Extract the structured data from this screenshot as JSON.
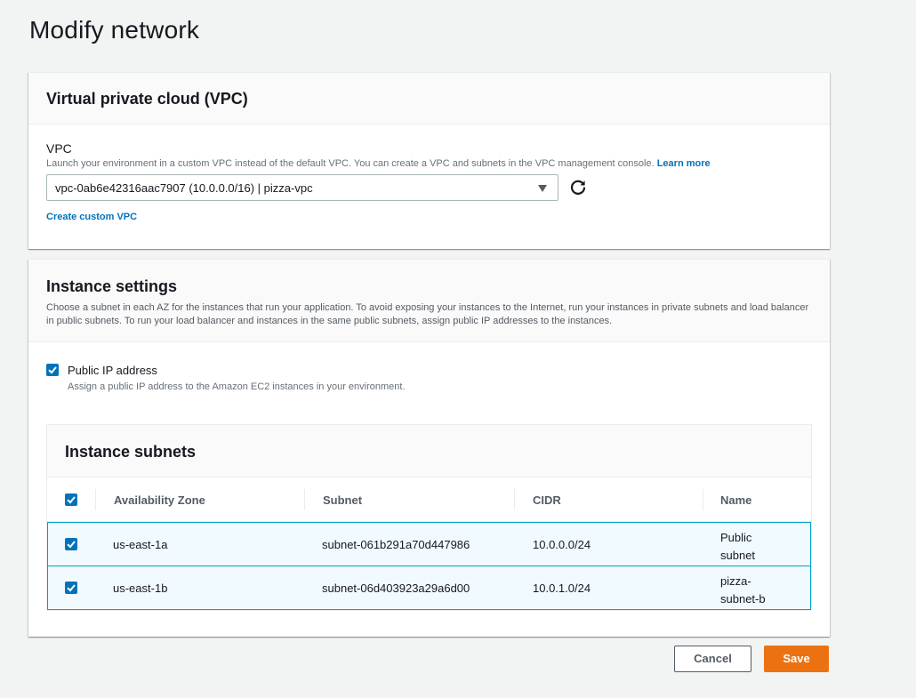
{
  "page": {
    "title": "Modify network"
  },
  "vpc_panel": {
    "title": "Virtual private cloud (VPC)",
    "vpc_label": "VPC",
    "vpc_description": "Launch your environment in a custom VPC instead of the default VPC. You can create a VPC and subnets in the VPC management console.",
    "learn_more": "Learn more",
    "vpc_selected": "vpc-0ab6e42316aac7907 (10.0.0.0/16) | pizza-vpc",
    "create_custom_vpc": "Create custom VPC",
    "refresh_icon": "refresh-icon"
  },
  "instance_panel": {
    "title": "Instance settings",
    "description": "Choose a subnet in each AZ for the instances that run your application. To avoid exposing your instances to the Internet, run your instances in private subnets and load balancer in public subnets. To run your load balancer and instances in the same public subnets, assign public IP addresses to the instances.",
    "public_ip_label": "Public IP address",
    "public_ip_description": "Assign a public IP address to the Amazon EC2 instances in your environment.",
    "public_ip_checked": true
  },
  "subnets": {
    "title": "Instance subnets",
    "columns": [
      "Availability Zone",
      "Subnet",
      "CIDR",
      "Name"
    ],
    "rows": [
      {
        "az": "us-east-1a",
        "subnet": "subnet-061b291a70d447986",
        "cidr": "10.0.0.0/24",
        "name_line1": "Public",
        "name_line2": "subnet",
        "checked": true
      },
      {
        "az": "us-east-1b",
        "subnet": "subnet-06d403923a29a6d00",
        "cidr": "10.0.1.0/24",
        "name_line1": "pizza-",
        "name_line2": "subnet-b",
        "checked": true
      }
    ]
  },
  "actions": {
    "cancel": "Cancel",
    "save": "Save"
  },
  "colors": {
    "accent": "#0073bb",
    "primary_button": "#ec7211",
    "selected_row_bg": "#f1faff",
    "selected_row_border": "#00a1c9"
  }
}
